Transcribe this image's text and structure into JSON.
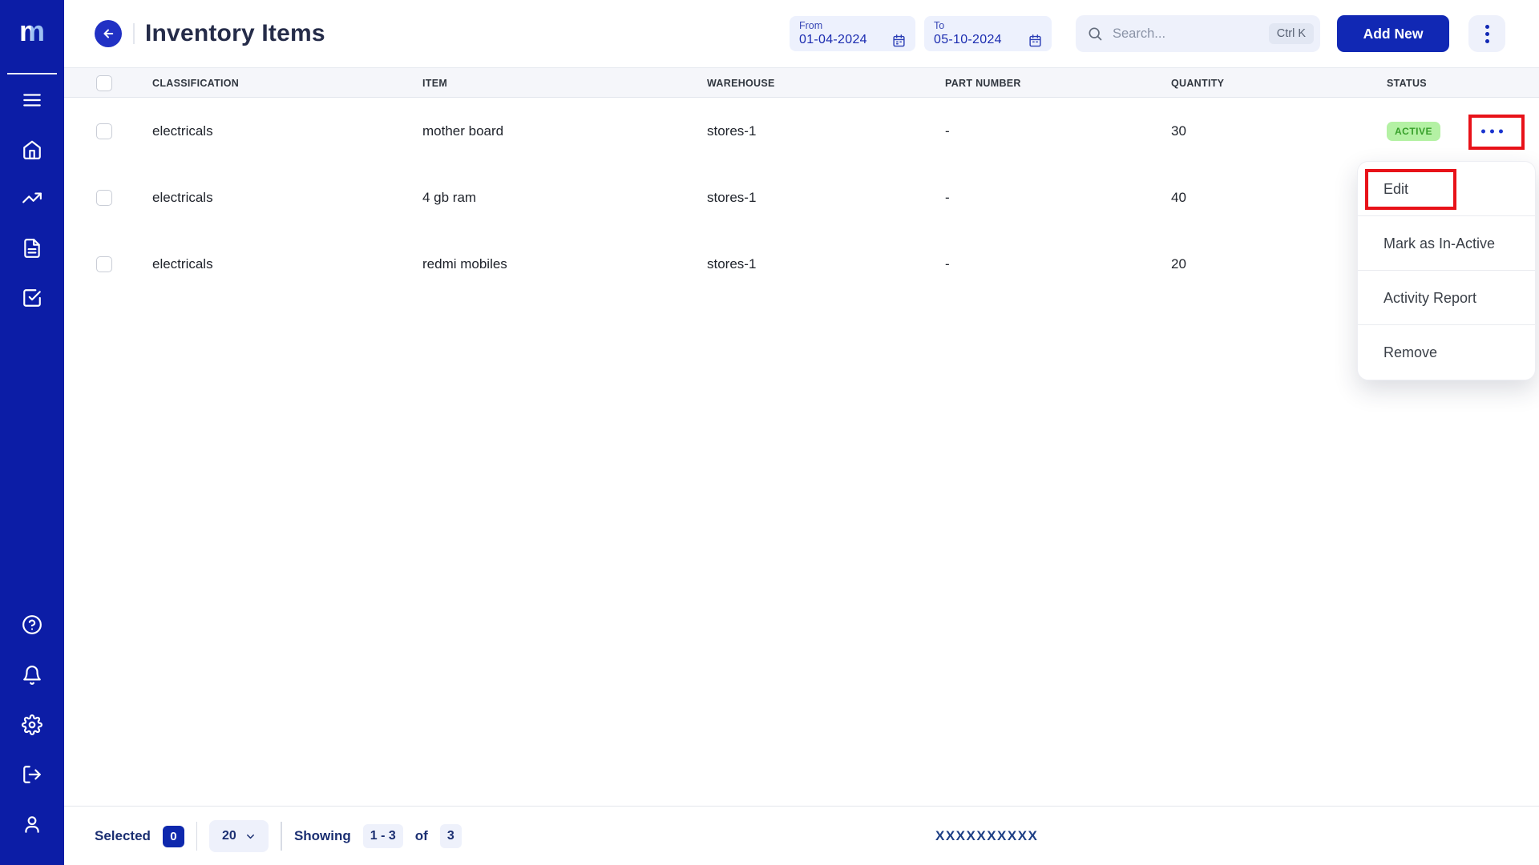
{
  "sidebar": {
    "logo_text": "m",
    "nav_icons": [
      {
        "icon": "menu-icon"
      },
      {
        "icon": "home-icon"
      },
      {
        "icon": "trending-up-icon"
      },
      {
        "icon": "document-icon"
      },
      {
        "icon": "check-square-icon"
      }
    ],
    "bottom_icons": [
      {
        "icon": "help-icon"
      },
      {
        "icon": "bell-icon"
      },
      {
        "icon": "gear-icon"
      },
      {
        "icon": "logout-icon"
      },
      {
        "icon": "user-icon"
      }
    ]
  },
  "header": {
    "title": "Inventory Items",
    "filters": {
      "from_label": "From",
      "from_value": "01-04-2024",
      "to_label": "To",
      "to_value": "05-10-2024"
    },
    "search": {
      "placeholder": "Search...",
      "shortcut": "Ctrl K"
    },
    "add_new_label": "Add New"
  },
  "table": {
    "columns": [
      "CLASSIFICATION",
      "ITEM",
      "WAREHOUSE",
      "PART NUMBER",
      "QUANTITY",
      "STATUS"
    ],
    "rows": [
      {
        "classification": "electricals",
        "item": "mother board",
        "warehouse": "stores-1",
        "part_number": "-",
        "quantity": "30",
        "status": "ACTIVE"
      },
      {
        "classification": "electricals",
        "item": "4 gb ram",
        "warehouse": "stores-1",
        "part_number": "-",
        "quantity": "40",
        "status": ""
      },
      {
        "classification": "electricals",
        "item": "redmi mobiles",
        "warehouse": "stores-1",
        "part_number": "-",
        "quantity": "20",
        "status": ""
      }
    ]
  },
  "context_menu": {
    "items": [
      "Edit",
      "Mark as In-Active",
      "Activity Report",
      "Remove"
    ]
  },
  "footer": {
    "selected_label": "Selected",
    "selected_count": "0",
    "page_size": "20",
    "showing_label": "Showing",
    "range": "1 - 3",
    "of_label": "of",
    "total": "3",
    "watermark": "XXXXXXXXXX"
  },
  "colors": {
    "sidebar_bg": "#0c1da6",
    "primary_button": "#1128b4",
    "chip_bg": "#eef1fb",
    "status_active_bg": "#b4f1a4",
    "status_active_text": "#37a02a",
    "annotation_red": "#e81219",
    "title_text": "#252c49",
    "footer_navy": "#1b2f72"
  }
}
